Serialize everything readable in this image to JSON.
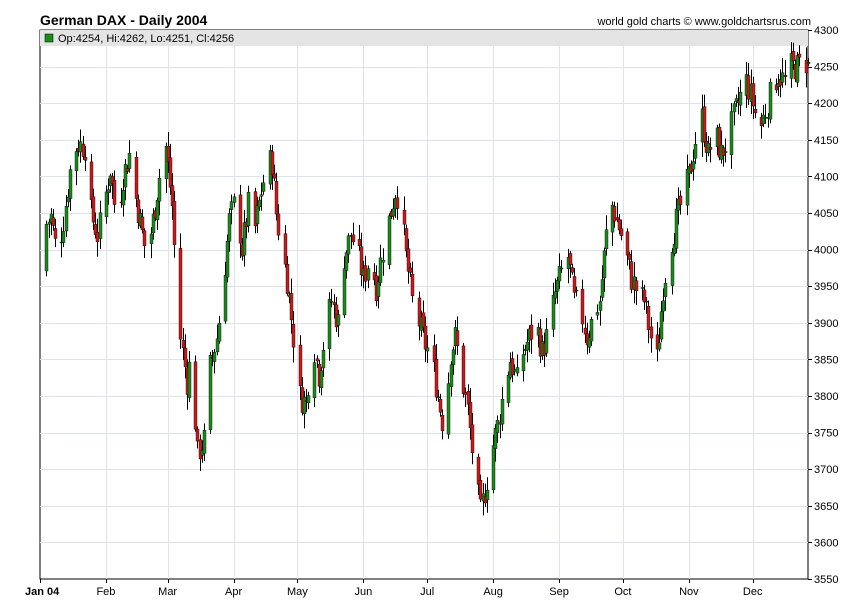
{
  "header": {
    "title": "German DAX - Daily 2004",
    "credit": "world gold charts © www.goldchartsrus.com"
  },
  "legend": {
    "text": "Op:4254, Hi:4262, Lo:4251, Cl:4256",
    "color": "#1a8c1a"
  },
  "colors": {
    "up": "#1a8c1a",
    "down": "#cc1a1a",
    "wick": "#000000",
    "grid": "#dde3ea",
    "legend_bg": "#e4e4e4"
  },
  "chart_data": {
    "type": "ohlc-candlestick",
    "title": "German DAX - Daily 2004",
    "ylim": [
      3550,
      4300
    ],
    "y_ticks": [
      3550,
      3600,
      3650,
      3700,
      3750,
      3800,
      3850,
      3900,
      3950,
      4000,
      4050,
      4100,
      4150,
      4200,
      4250,
      4300
    ],
    "x_ticks": [
      {
        "label": "Jan 04",
        "day": 0,
        "bold": true
      },
      {
        "label": "Feb",
        "day": 31
      },
      {
        "label": "Mar",
        "day": 60
      },
      {
        "label": "Apr",
        "day": 91
      },
      {
        "label": "May",
        "day": 121
      },
      {
        "label": "Jun",
        "day": 152
      },
      {
        "label": "Jul",
        "day": 182
      },
      {
        "label": "Aug",
        "day": 213
      },
      {
        "label": "Sep",
        "day": 244
      },
      {
        "label": "Oct",
        "day": 274
      },
      {
        "label": "Nov",
        "day": 305
      },
      {
        "label": "Dec",
        "day": 335
      }
    ],
    "x_range_days": [
      0,
      361
    ],
    "grid": true,
    "legend_position": "top-left",
    "close_anchors": [
      [
        0,
        3970
      ],
      [
        2,
        4030
      ],
      [
        5,
        4045
      ],
      [
        8,
        3990
      ],
      [
        11,
        4040
      ],
      [
        15,
        4130
      ],
      [
        18,
        4145
      ],
      [
        21,
        4140
      ],
      [
        24,
        4050
      ],
      [
        27,
        4020
      ],
      [
        30,
        4060
      ],
      [
        33,
        4110
      ],
      [
        36,
        4040
      ],
      [
        39,
        4100
      ],
      [
        42,
        4130
      ],
      [
        45,
        4070
      ],
      [
        50,
        3990
      ],
      [
        53,
        4040
      ],
      [
        56,
        4100
      ],
      [
        59,
        4140
      ],
      [
        62,
        4060
      ],
      [
        64,
        3950
      ],
      [
        66,
        3880
      ],
      [
        69,
        3820
      ],
      [
        71,
        3860
      ],
      [
        74,
        3720
      ],
      [
        77,
        3740
      ],
      [
        80,
        3840
      ],
      [
        83,
        3880
      ],
      [
        86,
        3950
      ],
      [
        89,
        4040
      ],
      [
        92,
        4070
      ],
      [
        95,
        4000
      ],
      [
        98,
        4060
      ],
      [
        101,
        4030
      ],
      [
        104,
        4080
      ],
      [
        107,
        4120
      ],
      [
        109,
        4120
      ],
      [
        111,
        4050
      ],
      [
        113,
        4010
      ],
      [
        116,
        3960
      ],
      [
        119,
        3880
      ],
      [
        122,
        3800
      ],
      [
        125,
        3790
      ],
      [
        128,
        3880
      ],
      [
        131,
        3830
      ],
      [
        134,
        3890
      ],
      [
        137,
        3930
      ],
      [
        140,
        3900
      ],
      [
        143,
        3990
      ],
      [
        146,
        4020
      ],
      [
        149,
        4000
      ],
      [
        152,
        3960
      ],
      [
        155,
        3990
      ],
      [
        158,
        3950
      ],
      [
        161,
        4000
      ],
      [
        164,
        4040
      ],
      [
        167,
        4080
      ],
      [
        169,
        4070
      ],
      [
        172,
        3990
      ],
      [
        175,
        3930
      ],
      [
        178,
        3900
      ],
      [
        181,
        3870
      ],
      [
        184,
        3850
      ],
      [
        187,
        3800
      ],
      [
        190,
        3750
      ],
      [
        193,
        3860
      ],
      [
        195,
        3880
      ],
      [
        198,
        3830
      ],
      [
        201,
        3780
      ],
      [
        204,
        3700
      ],
      [
        207,
        3640
      ],
      [
        209,
        3670
      ],
      [
        212,
        3720
      ],
      [
        215,
        3760
      ],
      [
        218,
        3810
      ],
      [
        221,
        3850
      ],
      [
        224,
        3820
      ],
      [
        227,
        3860
      ],
      [
        230,
        3880
      ],
      [
        233,
        3900
      ],
      [
        236,
        3860
      ],
      [
        239,
        3890
      ],
      [
        242,
        3940
      ],
      [
        245,
        3970
      ],
      [
        248,
        3990
      ],
      [
        251,
        3930
      ],
      [
        254,
        3920
      ],
      [
        257,
        3880
      ],
      [
        260,
        3910
      ],
      [
        263,
        3930
      ],
      [
        266,
        4020
      ],
      [
        269,
        4060
      ],
      [
        272,
        4030
      ],
      [
        275,
        4000
      ],
      [
        278,
        3960
      ],
      [
        281,
        3940
      ],
      [
        284,
        3930
      ],
      [
        287,
        3880
      ],
      [
        290,
        3850
      ],
      [
        293,
        3950
      ],
      [
        296,
        4000
      ],
      [
        299,
        4040
      ],
      [
        302,
        4070
      ],
      [
        305,
        4100
      ],
      [
        308,
        4150
      ],
      [
        311,
        4180
      ],
      [
        314,
        4130
      ],
      [
        317,
        4160
      ],
      [
        320,
        4130
      ],
      [
        323,
        4150
      ],
      [
        326,
        4180
      ],
      [
        329,
        4210
      ],
      [
        332,
        4230
      ],
      [
        335,
        4200
      ],
      [
        338,
        4160
      ],
      [
        341,
        4190
      ],
      [
        344,
        4220
      ],
      [
        347,
        4240
      ],
      [
        350,
        4230
      ],
      [
        353,
        4250
      ],
      [
        356,
        4250
      ],
      [
        359,
        4256
      ]
    ]
  }
}
